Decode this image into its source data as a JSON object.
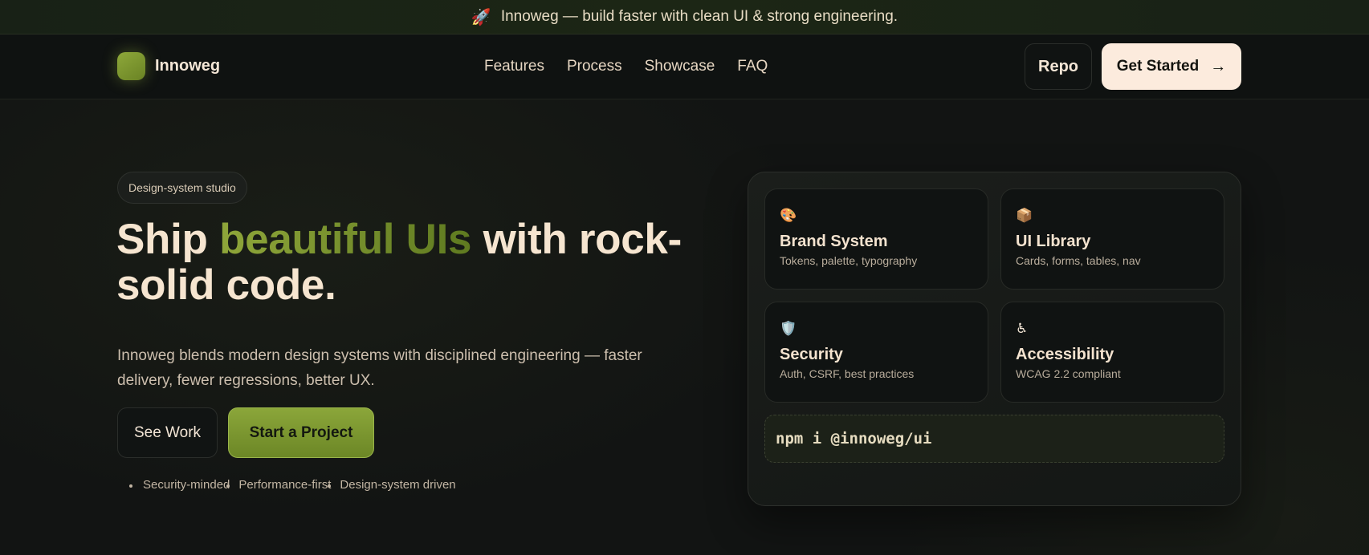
{
  "announcement": {
    "icon": "🚀",
    "text": "Innoweg — build faster with clean UI & strong engineering."
  },
  "nav": {
    "brand": "Innoweg",
    "links": [
      "Features",
      "Process",
      "Showcase",
      "FAQ"
    ],
    "repo_label": "Repo",
    "cta_label": "Get Started",
    "cta_icon": "→"
  },
  "hero": {
    "badge": "Design-system studio",
    "title_start": "Ship ",
    "title_accent": "beautiful UIs",
    "title_end": " with rock-solid code.",
    "description": "Innoweg blends modern design systems with disciplined engineering — faster delivery, fewer regressions, better UX.",
    "secondary_button": "See Work",
    "primary_button": "Start a Project",
    "tags": [
      "Security-minded",
      "Performance-first",
      "Design-system driven"
    ]
  },
  "panel": {
    "cards": [
      {
        "icon": "🎨",
        "title": "Brand System",
        "subtitle": "Tokens, palette, typography"
      },
      {
        "icon": "📦",
        "title": "UI Library",
        "subtitle": "Cards, forms, tables, nav"
      },
      {
        "icon": "🛡️",
        "title": "Security",
        "subtitle": "Auth, CSRF, best practices"
      },
      {
        "icon": "♿",
        "title": "Accessibility",
        "subtitle": "WCAG 2.2 compliant"
      }
    ],
    "install_command": "npm i @innoweg/ui"
  },
  "colors": {
    "accent": "#8ba63a",
    "cta_bg": "#fcebdd",
    "background": "#121413"
  }
}
